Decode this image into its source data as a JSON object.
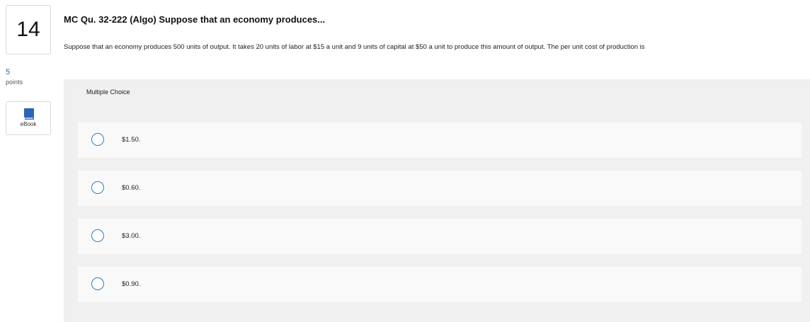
{
  "question": {
    "number": "14",
    "points_value": "5",
    "points_label": "points",
    "ebook_label": "eBook",
    "title": "MC Qu. 32-222 (Algo) Suppose that an economy produces...",
    "text": "Suppose that an economy produces 500 units of output. It takes 20 units of labor at $15 a unit and 9 units of capital at $50 a unit to produce this amount of output. The per unit cost of production is"
  },
  "answers": {
    "type_label": "Multiple Choice",
    "choices": [
      {
        "label": "$1.50."
      },
      {
        "label": "$0.60."
      },
      {
        "label": "$3.00."
      },
      {
        "label": "$0.90."
      }
    ]
  },
  "colors": {
    "radio_border": "#2f7fbf",
    "points_value": "#2a6ebb",
    "ebook_icon": "#2c64b8",
    "panel_bg": "#f0f0f0"
  }
}
